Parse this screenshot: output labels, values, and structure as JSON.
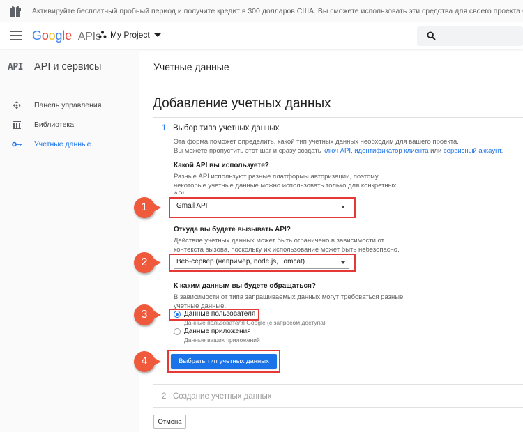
{
  "promo": {
    "text": "Активируйте бесплатный пробный период и получите кредит в 300 долларов США. Вы сможете использовать эти средства для своего проекта Google Cl"
  },
  "topbar": {
    "logo_google": "Google",
    "logo_apis": "APIs",
    "project_name": "My Project"
  },
  "sidebar": {
    "logo": "API",
    "title": "API и сервисы",
    "items": [
      {
        "label": "Панель управления",
        "icon": "dashboard-icon"
      },
      {
        "label": "Библиотека",
        "icon": "library-icon"
      },
      {
        "label": "Учетные данные",
        "icon": "key-icon",
        "active": true
      }
    ]
  },
  "main": {
    "header": "Учетные данные",
    "page_title": "Добавление учетных данных"
  },
  "step1": {
    "number": "1",
    "title": "Выбор типа учетных данных",
    "intro_line1": "Эта форма поможет определить, какой тип учетных данных необходим для вашего проекта.",
    "intro_line2_prefix": "Вы можете пропустить этот шаг и сразу создать ",
    "link_api_key": "ключ API",
    "sep1": ", ",
    "link_client_id": "идентификатор клиента",
    "sep2": " или ",
    "link_service_account": "сервисный аккаунт",
    "intro_line2_suffix": "."
  },
  "q1": {
    "title": "Какой API вы используете?",
    "desc1": "Разные API используют разные платформы авторизации, поэтому",
    "desc2": "некоторые учетные данные можно использовать только для конкретных",
    "desc3": "API.",
    "value": "Gmail API"
  },
  "q2": {
    "title": "Откуда вы будете вызывать API?",
    "desc1": "Действие учетных данных может быть ограничено в зависимости от",
    "desc2": "контекста вызова, поскольку их использование может быть небезопасно.",
    "value": "Веб-сервер (например, node.js, Tomcat)"
  },
  "q3": {
    "title": "К каким данным вы будете обращаться?",
    "desc1": "В зависимости от типа запрашиваемых данных могут требоваться разные",
    "desc2": "учетные данные.",
    "option1_label": "Данные пользователя",
    "option1_sub": "Данные пользователя Google (с запросом доступа)",
    "option2_label": "Данные приложения",
    "option2_sub": "Данные ваших приложений",
    "selected": "option1"
  },
  "actions": {
    "choose_label": "Выбрать тип учетных данных",
    "cancel_label": "Отмена"
  },
  "step2": {
    "number": "2",
    "title": "Создание учетных данных"
  },
  "callouts": [
    "1",
    "2",
    "3",
    "4"
  ],
  "colors": {
    "accent": "#1a73e8",
    "callout": "#ef5a3c",
    "highlight": "#e53935"
  }
}
